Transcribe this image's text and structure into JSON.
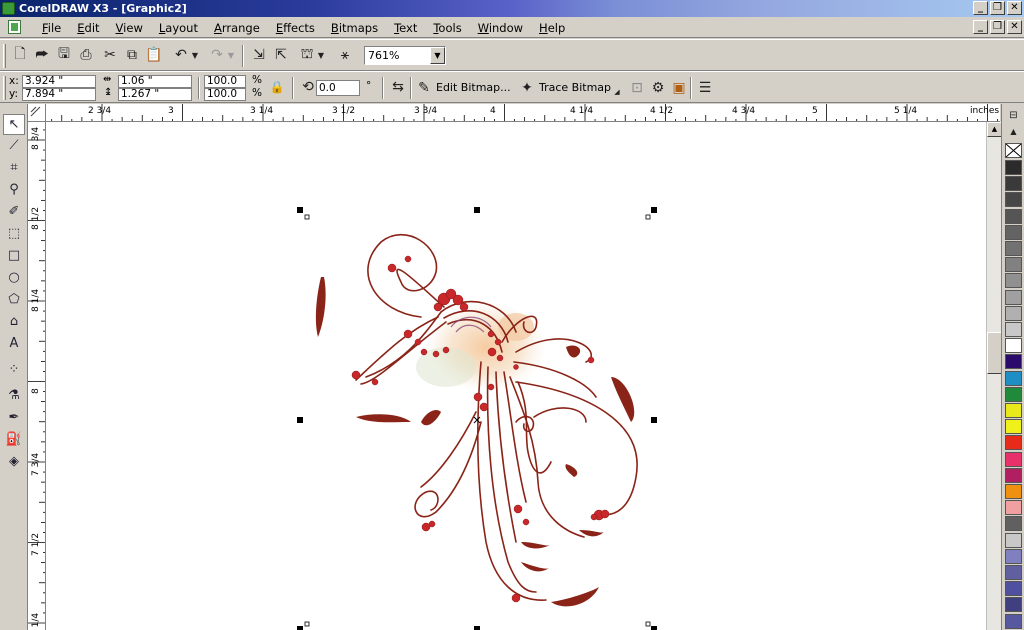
{
  "window": {
    "title": "CorelDRAW X3 - [Graphic2]"
  },
  "menu": [
    "File",
    "Edit",
    "View",
    "Layout",
    "Arrange",
    "Effects",
    "Bitmaps",
    "Text",
    "Tools",
    "Window",
    "Help"
  ],
  "toolbar": {
    "zoom": "761%"
  },
  "property_bar": {
    "x": "3.924 \"",
    "y": "7.894 \"",
    "width": "1.06 \"",
    "height": "1.267 \"",
    "scale_x": "100.0",
    "scale_y": "100.0",
    "percent": "%",
    "rotation": "0.0",
    "degree": "°",
    "edit_bitmap": "Edit Bitmap...",
    "trace_bitmap": "Trace Bitmap"
  },
  "hruler": {
    "unit": "inches",
    "labels": [
      {
        "text": "2 3/4"
      },
      {
        "text": "3"
      },
      {
        "text": "3 1/4"
      },
      {
        "text": "3 1/2"
      },
      {
        "text": "3 3/4"
      },
      {
        "text": "4"
      },
      {
        "text": "4 1/4"
      },
      {
        "text": "4 1/2"
      },
      {
        "text": "4 3/4"
      },
      {
        "text": "5"
      },
      {
        "text": "5 1/4"
      }
    ]
  },
  "vruler": {
    "labels": [
      {
        "text": "8 3/4"
      },
      {
        "text": "8 1/2"
      },
      {
        "text": "8 1/4"
      },
      {
        "text": "8"
      },
      {
        "text": "7 3/4"
      },
      {
        "text": "7 1/2"
      },
      {
        "text": "7 1/4"
      }
    ]
  },
  "palette": {
    "colors": [
      "#2b2b2b",
      "#3a3a3a",
      "#474747",
      "#555555",
      "#636363",
      "#727272",
      "#818181",
      "#909090",
      "#a0a0a0",
      "#b0b0b0",
      "#c8c8c8",
      "#ffffff",
      "#2a0a6a",
      "#1f8ec4",
      "#1f8a3a",
      "#e8e81a",
      "#f0f01a",
      "#e82a1a",
      "#e8306a",
      "#b02060",
      "#f09010",
      "#f0a0a0",
      "#606060",
      "#c8c8c8",
      "#8080c0",
      "#6060a0",
      "#5050a0",
      "#404080",
      "#5858a0"
    ]
  },
  "colors": {
    "ink": "#8a2418",
    "blossom": "#c8282a"
  }
}
